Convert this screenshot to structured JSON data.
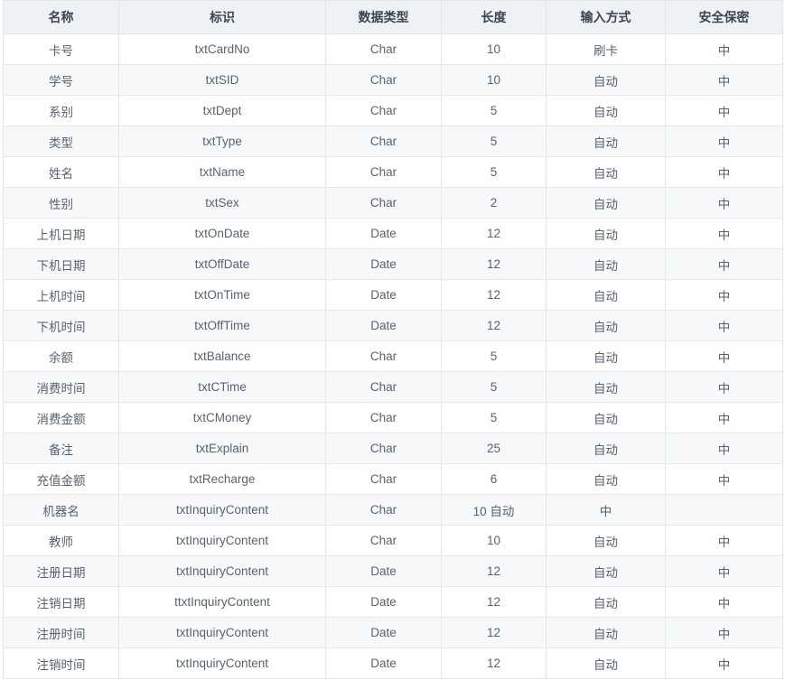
{
  "table": {
    "columns": [
      {
        "key": "name",
        "label": "名称"
      },
      {
        "key": "ident",
        "label": "标识"
      },
      {
        "key": "type",
        "label": "数据类型"
      },
      {
        "key": "len",
        "label": "长度"
      },
      {
        "key": "input",
        "label": "输入方式"
      },
      {
        "key": "sec",
        "label": "安全保密"
      }
    ],
    "rows": [
      {
        "name": "卡号",
        "ident": "txtCardNo",
        "type": "Char",
        "len": "10",
        "input": "刷卡",
        "sec": "中"
      },
      {
        "name": "学号",
        "ident": "txtSID",
        "type": "Char",
        "len": "10",
        "input": "自动",
        "sec": "中"
      },
      {
        "name": "系别",
        "ident": "txtDept",
        "type": "Char",
        "len": "5",
        "input": "自动",
        "sec": "中"
      },
      {
        "name": "类型",
        "ident": "txtType",
        "type": "Char",
        "len": "5",
        "input": "自动",
        "sec": "中"
      },
      {
        "name": "姓名",
        "ident": "txtName",
        "type": "Char",
        "len": "5",
        "input": "自动",
        "sec": "中"
      },
      {
        "name": "性别",
        "ident": "txtSex",
        "type": "Char",
        "len": "2",
        "input": "自动",
        "sec": "中"
      },
      {
        "name": "上机日期",
        "ident": "txtOnDate",
        "type": "Date",
        "len": "12",
        "input": "自动",
        "sec": "中"
      },
      {
        "name": "下机日期",
        "ident": "txtOffDate",
        "type": "Date",
        "len": "12",
        "input": "自动",
        "sec": "中"
      },
      {
        "name": "上机时间",
        "ident": "txtOnTime",
        "type": "Date",
        "len": "12",
        "input": "自动",
        "sec": "中"
      },
      {
        "name": "下机时间",
        "ident": "txtOffTime",
        "type": "Date",
        "len": "12",
        "input": "自动",
        "sec": "中"
      },
      {
        "name": "余额",
        "ident": "txtBalance",
        "type": "Char",
        "len": "5",
        "input": "自动",
        "sec": "中"
      },
      {
        "name": "消费时间",
        "ident": "txtCTime",
        "type": "Char",
        "len": "5",
        "input": "自动",
        "sec": "中"
      },
      {
        "name": "消费金额",
        "ident": "txtCMoney",
        "type": "Char",
        "len": "5",
        "input": "自动",
        "sec": "中"
      },
      {
        "name": "备注",
        "ident": "txtExplain",
        "type": "Char",
        "len": "25",
        "input": "自动",
        "sec": "中"
      },
      {
        "name": "充值金额",
        "ident": "txtRecharge",
        "type": "Char",
        "len": "6",
        "input": "自动",
        "sec": "中"
      },
      {
        "name": "机器名",
        "ident": "txtInquiryContent",
        "type": "Char",
        "len": "10 自动",
        "input": "中",
        "sec": ""
      },
      {
        "name": "教师",
        "ident": "txtInquiryContent",
        "type": "Char",
        "len": "10",
        "input": "自动",
        "sec": "中"
      },
      {
        "name": "注册日期",
        "ident": "txtInquiryContent",
        "type": "Date",
        "len": "12",
        "input": "自动",
        "sec": "中"
      },
      {
        "name": "注销日期",
        "ident": "ttxtInquiryContent",
        "type": "Date",
        "len": "12",
        "input": "自动",
        "sec": "中"
      },
      {
        "name": "注册时间",
        "ident": "txtInquiryContent",
        "type": "Date",
        "len": "12",
        "input": "自动",
        "sec": "中"
      },
      {
        "name": "注销时间",
        "ident": "txtInquiryContent",
        "type": "Date",
        "len": "12",
        "input": "自动",
        "sec": "中"
      }
    ]
  },
  "colors": {
    "header_bg": "#eef2f5",
    "header_text": "#3c4552",
    "row_odd_bg": "#ffffff",
    "row_even_bg": "#f7f8f9",
    "body_text": "#5a6270",
    "border": "#e3e6e8"
  }
}
